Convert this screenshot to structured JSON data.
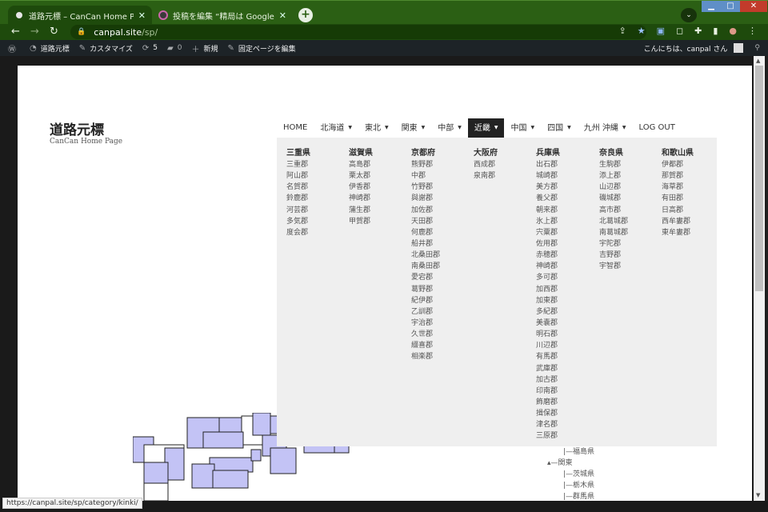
{
  "browser": {
    "tabs": [
      {
        "title": "道路元標 – CanCan Home Page",
        "close": "✕"
      },
      {
        "title": "投稿を編集 “精局は GoogleMap",
        "close": "✕"
      }
    ],
    "new_tab": "+",
    "url_host": "canpal.site",
    "url_path": "/sp/",
    "status_url": "https://canpal.site/sp/category/kinki/"
  },
  "adminbar": {
    "site": "道路元標",
    "customize": "カスタマイズ",
    "updates": "5",
    "comments": "0",
    "new": "新規",
    "edit": "固定ページを編集",
    "greeting": "こんにちは、canpal さん"
  },
  "site": {
    "title": "道路元標",
    "tagline": "CanCan Home Page"
  },
  "menu": {
    "items": [
      {
        "label": "HOME",
        "dropdown": false
      },
      {
        "label": "北海道",
        "dropdown": true
      },
      {
        "label": "東北",
        "dropdown": true
      },
      {
        "label": "関東",
        "dropdown": true
      },
      {
        "label": "中部",
        "dropdown": true
      },
      {
        "label": "近畿",
        "dropdown": true,
        "active": true
      },
      {
        "label": "中国",
        "dropdown": true
      },
      {
        "label": "四国",
        "dropdown": true
      },
      {
        "label": "九州 沖縄",
        "dropdown": true
      },
      {
        "label": "LOG OUT",
        "dropdown": false
      }
    ]
  },
  "mega": {
    "columns": [
      {
        "head": "三重県",
        "items": [
          "三重郡",
          "阿山郡",
          "名賀郡",
          "鈴鹿郡",
          "河芸郡",
          "多気郡",
          "度会郡"
        ]
      },
      {
        "head": "滋賀県",
        "items": [
          "高島郡",
          "栗太郡",
          "伊香郡",
          "神崎郡",
          "蒲生郡",
          "甲賀郡"
        ]
      },
      {
        "head": "京都府",
        "items": [
          "熊野郡",
          "中郡",
          "竹野郡",
          "與謝郡",
          "加佐郡",
          "天田郡",
          "何鹿郡",
          "船井郡",
          "北桑田郡",
          "南桑田郡",
          "愛宕郡",
          "葛野郡",
          "紀伊郡",
          "乙訓郡",
          "宇治郡",
          "久世郡",
          "綴喜郡",
          "相楽郡"
        ]
      },
      {
        "head": "大阪府",
        "items": [
          "西成郡",
          "泉南郡"
        ]
      },
      {
        "head": "兵庫県",
        "items": [
          "出石郡",
          "城崎郡",
          "美方郡",
          "養父郡",
          "朝来郡",
          "氷上郡",
          "宍粟郡",
          "佐用郡",
          "赤穂郡",
          "神崎郡",
          "多可郡",
          "加西郡",
          "加東郡",
          "多紀郡",
          "美嚢郡",
          "明石郡",
          "川辺郡",
          "有馬郡",
          "武庫郡",
          "加古郡",
          "印南郡",
          "飾磨郡",
          "揖保郡",
          "津名郡",
          "三原郡"
        ]
      },
      {
        "head": "奈良県",
        "items": [
          "生駒郡",
          "添上郡",
          "山辺郡",
          "磯城郡",
          "高市郡",
          "北葛城郡",
          "南葛城郡",
          "宇陀郡",
          "吉野郡",
          "宇智郡"
        ]
      },
      {
        "head": "和歌山県",
        "items": [
          "伊都郡",
          "那賀郡",
          "海草郡",
          "有田郡",
          "日高郡",
          "西牟婁郡",
          "東牟婁郡"
        ]
      }
    ]
  },
  "tree": [
    "|—福島県",
    "▴—関東",
    "|—茨城県",
    "|—栃木県",
    "|—群馬県"
  ],
  "colors": {
    "map_fill": "#c3c3f5",
    "tab_green": "#2b5f14",
    "admin_bg": "#1d2327"
  }
}
